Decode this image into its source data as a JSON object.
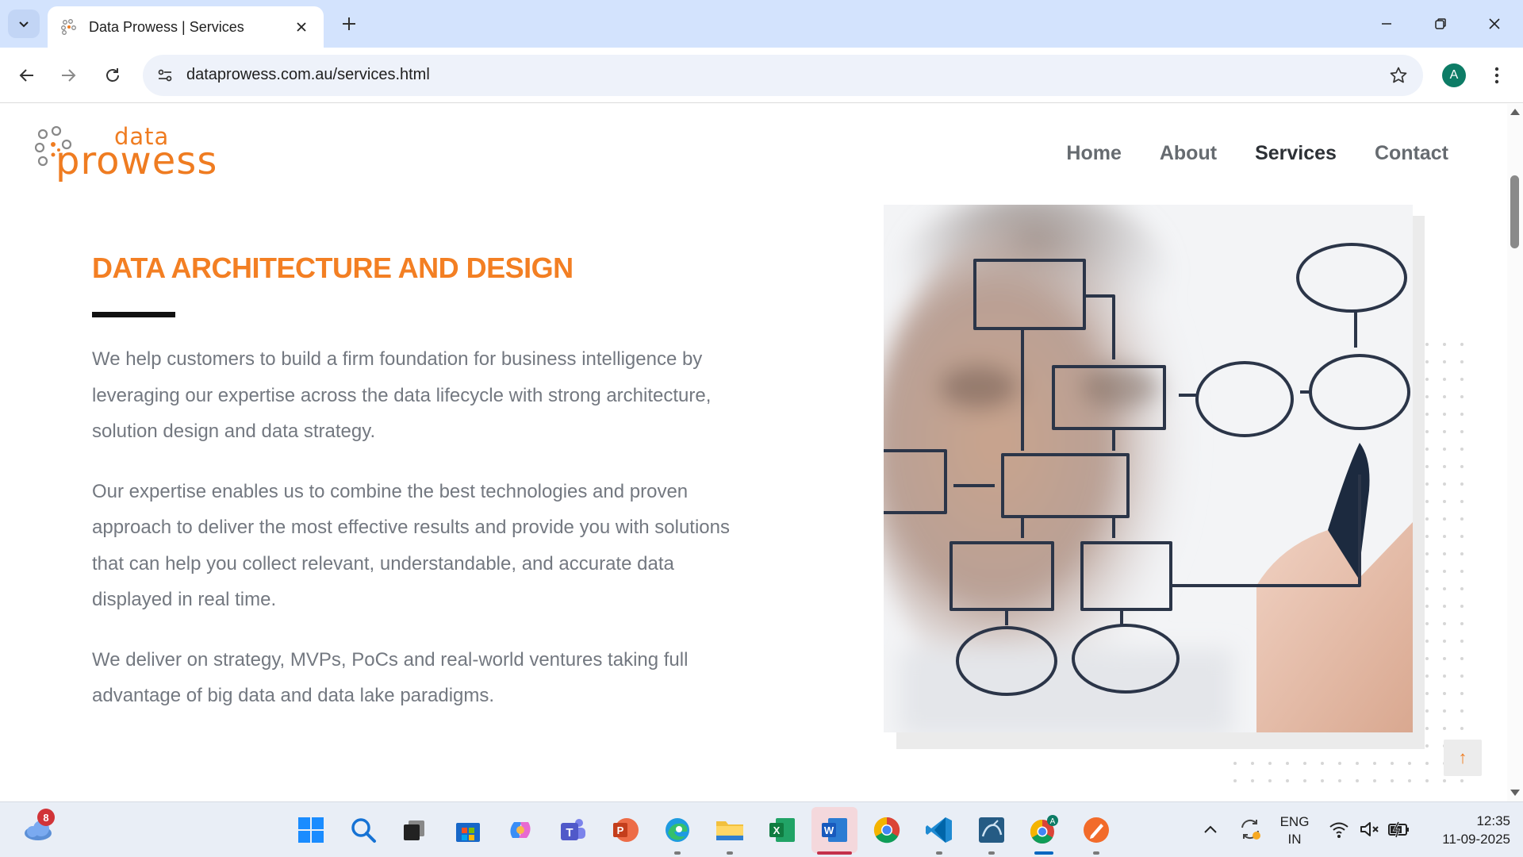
{
  "browser": {
    "tab_title": "Data Prowess | Services",
    "url": "dataprowess.com.au/services.html",
    "profile_initial": "A"
  },
  "site": {
    "logo_line1": "data",
    "logo_line2": "prowess",
    "nav": [
      {
        "label": "Home"
      },
      {
        "label": "About"
      },
      {
        "label": "Services"
      },
      {
        "label": "Contact"
      }
    ],
    "active_nav": "Services"
  },
  "content": {
    "heading": "DATA ARCHITECTURE AND DESIGN",
    "paragraphs": [
      "We help customers to build a firm foundation for business intelligence by leveraging our expertise across the data lifecycle with strong architecture, solution design and data strategy.",
      "Our expertise enables us to combine the best technologies and proven approach to deliver the most effective results and provide you with solutions that can help you collect relevant, understandable, and accurate data displayed in real time.",
      "We deliver on strategy, MVPs, PoCs and real-world ventures taking full advantage of big data and data lake paradigms."
    ],
    "scroll_top_glyph": "↑"
  },
  "colors": {
    "brand_orange": "#f37f23",
    "nav_text": "#666b70",
    "nav_active": "#2d3136",
    "body_text": "#737880"
  },
  "taskbar": {
    "weather_badge": "8",
    "apps": [
      "start",
      "search",
      "task-view",
      "store",
      "copilot",
      "teams",
      "powerpoint",
      "edge",
      "file-explorer",
      "excel",
      "word",
      "chrome",
      "vscode",
      "mysql-workbench",
      "chrome-profile",
      "pen-app"
    ],
    "active_app": "word",
    "language_line1": "ENG",
    "language_line2": "IN",
    "time": "12:35",
    "date": "11-09-2025"
  }
}
